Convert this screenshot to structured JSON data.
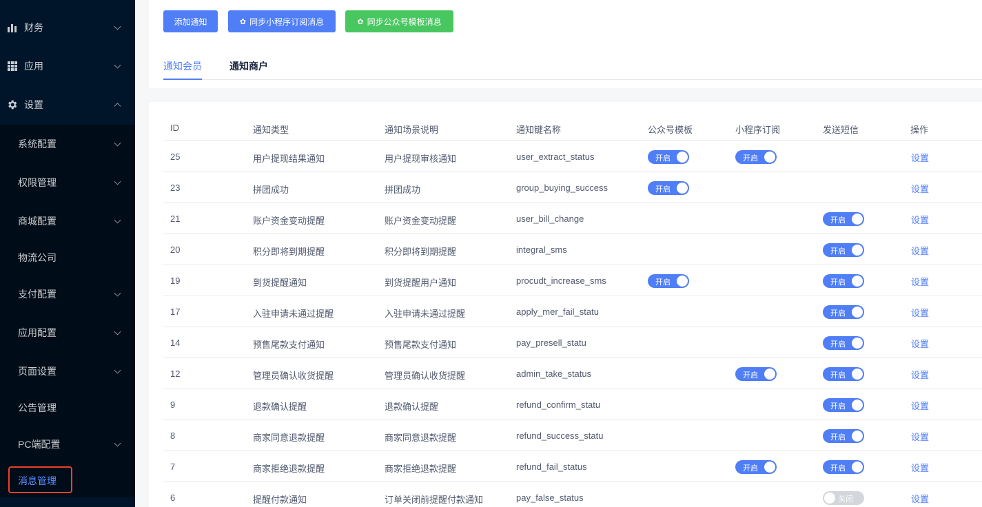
{
  "sidebar": {
    "menu": [
      {
        "label": "财务",
        "icon": "bar-chart-icon"
      },
      {
        "label": "应用",
        "icon": "grid-icon"
      },
      {
        "label": "设置",
        "icon": "gear-icon"
      }
    ],
    "submenu": [
      {
        "label": "系统配置",
        "has_arrow": true
      },
      {
        "label": "权限管理",
        "has_arrow": true
      },
      {
        "label": "商城配置",
        "has_arrow": true
      },
      {
        "label": "物流公司",
        "has_arrow": false
      },
      {
        "label": "支付配置",
        "has_arrow": true
      },
      {
        "label": "应用配置",
        "has_arrow": true
      },
      {
        "label": "页面设置",
        "has_arrow": true
      },
      {
        "label": "公告管理",
        "has_arrow": false
      },
      {
        "label": "PC端配置",
        "has_arrow": true
      },
      {
        "label": "消息管理",
        "has_arrow": false,
        "active": true
      }
    ]
  },
  "toolbar": {
    "add_label": "添加通知",
    "sync_mini_label": "同步小程序订阅消息",
    "sync_wechat_label": "同步公众号模板消息"
  },
  "tabs": [
    {
      "label": "通知会员",
      "active": true
    },
    {
      "label": "通知商户",
      "active": false
    }
  ],
  "table": {
    "headers": {
      "id": "ID",
      "type": "通知类型",
      "scene": "通知场景说明",
      "key": "通知键名称",
      "wechat": "公众号模板",
      "mini": "小程序订阅",
      "sms": "发送短信",
      "action": "操作"
    },
    "switch_on_label": "开启",
    "switch_off_label": "关闭",
    "action_label": "设置",
    "rows": [
      {
        "id": "25",
        "type": "用户提现结果通知",
        "scene": "用户提现审核通知",
        "key": "user_extract_status",
        "wechat": "on",
        "mini": "on",
        "sms": null
      },
      {
        "id": "23",
        "type": "拼团成功",
        "scene": "拼团成功",
        "key": "group_buying_success",
        "wechat": "on",
        "mini": null,
        "sms": null
      },
      {
        "id": "21",
        "type": "账户资金变动提醒",
        "scene": "账户资金变动提醒",
        "key": "user_bill_change",
        "wechat": null,
        "mini": null,
        "sms": "on"
      },
      {
        "id": "20",
        "type": "积分即将到期提醒",
        "scene": "积分即将到期提醒",
        "key": "integral_sms",
        "wechat": null,
        "mini": null,
        "sms": "on"
      },
      {
        "id": "19",
        "type": "到货提醒通知",
        "scene": "到货提醒用户通知",
        "key": "procudt_increase_sms",
        "wechat": "on",
        "mini": null,
        "sms": "on"
      },
      {
        "id": "17",
        "type": "入驻申请未通过提醒",
        "scene": "入驻申请未通过提醒",
        "key": "apply_mer_fail_statu",
        "wechat": null,
        "mini": null,
        "sms": "on"
      },
      {
        "id": "14",
        "type": "预售尾款支付通知",
        "scene": "预售尾款支付通知",
        "key": "pay_presell_statu",
        "wechat": null,
        "mini": null,
        "sms": "on"
      },
      {
        "id": "12",
        "type": "管理员确认收货提醒",
        "scene": "管理员确认收货提醒",
        "key": "admin_take_status",
        "wechat": null,
        "mini": "on",
        "sms": "on"
      },
      {
        "id": "9",
        "type": "退款确认提醒",
        "scene": "退款确认提醒",
        "key": "refund_confirm_statu",
        "wechat": null,
        "mini": null,
        "sms": "on"
      },
      {
        "id": "8",
        "type": "商家同意退款提醒",
        "scene": "商家同意退款提醒",
        "key": "refund_success_statu",
        "wechat": null,
        "mini": null,
        "sms": "on"
      },
      {
        "id": "7",
        "type": "商家拒绝退款提醒",
        "scene": "商家拒绝退款提醒",
        "key": "refund_fail_status",
        "wechat": null,
        "mini": "on",
        "sms": "on"
      },
      {
        "id": "6",
        "type": "提醒付款通知",
        "scene": "订单关闭前提醒付款通知",
        "key": "pay_false_status",
        "wechat": null,
        "mini": null,
        "sms": "off"
      }
    ]
  },
  "colors": {
    "sidebar_bg": "#001529",
    "submenu_bg": "#000c17",
    "primary": "#4f7ef6",
    "success": "#48c760",
    "active_frame": "#e8412f"
  }
}
